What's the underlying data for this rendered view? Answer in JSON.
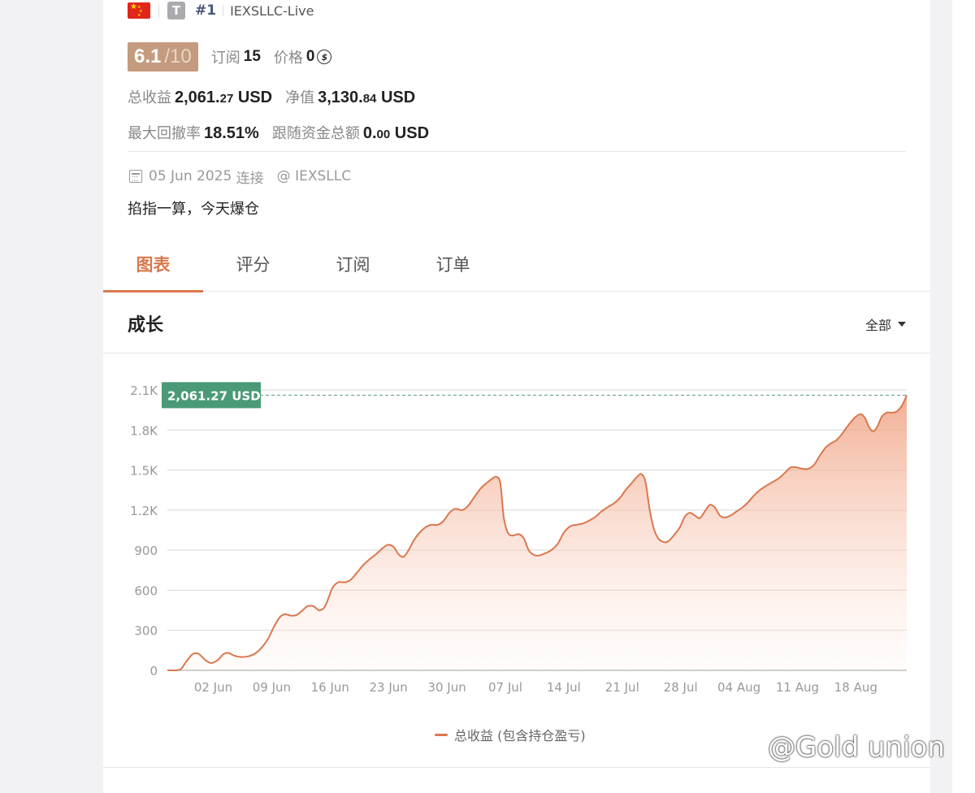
{
  "header": {
    "badge_letter": "T",
    "rank": "#1",
    "account_name": "IEXSLLC-Live"
  },
  "score": {
    "value": "6.1",
    "max": "/10",
    "subscribe_label": "订阅",
    "subscribe_count": "15",
    "price_label": "价格",
    "price_value": "0",
    "coin_glyph": "$"
  },
  "stats": {
    "total_profit_label": "总收益",
    "total_profit_int": "2,061.",
    "total_profit_dec": "27",
    "total_profit_unit": "USD",
    "equity_label": "净值",
    "equity_int": "3,130.",
    "equity_dec": "84",
    "equity_unit": "USD",
    "drawdown_label": "最大回撤率",
    "drawdown_value": "18.51%",
    "follow_label": "跟随资金总额",
    "follow_int": "0.",
    "follow_dec": "00",
    "follow_unit": "USD"
  },
  "connection": {
    "date": "05 Jun 2025",
    "connected_label": "连接",
    "broker": "@ IEXSLLC"
  },
  "description": "掐指一算，今天爆仓",
  "tabs": [
    {
      "label": "图表",
      "active": true
    },
    {
      "label": "评分",
      "active": false
    },
    {
      "label": "订阅",
      "active": false
    },
    {
      "label": "订单",
      "active": false
    }
  ],
  "section": {
    "title": "成长",
    "range_label": "全部"
  },
  "legend_label": "总收益 (包含持仓盈亏)",
  "watermark": "@Gold union",
  "colors": {
    "accent": "#d9784e",
    "score_bg": "#c49b7e",
    "tooltip_bg": "#4a9a78",
    "reference_line": "#5a9a82"
  },
  "chart_data": {
    "type": "area",
    "ylim": [
      0,
      2100
    ],
    "y_ticks": [
      0,
      300,
      600,
      900,
      1200,
      1500,
      1800,
      2100
    ],
    "y_tick_labels": [
      "0",
      "300",
      "600",
      "900",
      "1.2K",
      "1.5K",
      "1.8K",
      "2.1K"
    ],
    "x_tick_labels": [
      "02 Jun",
      "09 Jun",
      "16 Jun",
      "23 Jun",
      "30 Jun",
      "07 Jul",
      "14 Jul",
      "21 Jul",
      "28 Jul",
      "04 Aug",
      "11 Aug",
      "18 Aug"
    ],
    "x_range_days": [
      -5.5,
      77
    ],
    "current_value_label": "2,061.27 USD",
    "current_value": 2061.27,
    "series": [
      {
        "name": "总收益 (包含持仓盈亏)",
        "points": [
          [
            -5.5,
            0
          ],
          [
            -4,
            5
          ],
          [
            -3.3,
            60
          ],
          [
            -2.5,
            120
          ],
          [
            -1.8,
            125
          ],
          [
            -1,
            80
          ],
          [
            -0.3,
            55
          ],
          [
            0.5,
            75
          ],
          [
            1.2,
            120
          ],
          [
            1.8,
            130
          ],
          [
            2.5,
            110
          ],
          [
            3.3,
            100
          ],
          [
            4.2,
            105
          ],
          [
            5,
            125
          ],
          [
            5.8,
            170
          ],
          [
            6.6,
            240
          ],
          [
            7.3,
            330
          ],
          [
            8,
            400
          ],
          [
            8.6,
            420
          ],
          [
            9.3,
            410
          ],
          [
            10,
            415
          ],
          [
            10.7,
            450
          ],
          [
            11.3,
            480
          ],
          [
            12,
            480
          ],
          [
            12.7,
            450
          ],
          [
            13.3,
            470
          ],
          [
            13.8,
            540
          ],
          [
            14.3,
            620
          ],
          [
            15,
            660
          ],
          [
            15.8,
            660
          ],
          [
            16.5,
            680
          ],
          [
            17.2,
            730
          ],
          [
            18,
            790
          ],
          [
            18.7,
            830
          ],
          [
            19.5,
            870
          ],
          [
            20.2,
            910
          ],
          [
            20.9,
            940
          ],
          [
            21.6,
            925
          ],
          [
            22.2,
            870
          ],
          [
            22.8,
            850
          ],
          [
            23.4,
            900
          ],
          [
            24,
            970
          ],
          [
            24.7,
            1030
          ],
          [
            25.4,
            1070
          ],
          [
            26.1,
            1090
          ],
          [
            26.9,
            1090
          ],
          [
            27.6,
            1120
          ],
          [
            28.3,
            1180
          ],
          [
            29,
            1210
          ],
          [
            29.8,
            1200
          ],
          [
            30.5,
            1230
          ],
          [
            31.2,
            1290
          ],
          [
            32,
            1360
          ],
          [
            32.7,
            1400
          ],
          [
            33.3,
            1430
          ],
          [
            33.9,
            1450
          ],
          [
            34.4,
            1400
          ],
          [
            34.8,
            1150
          ],
          [
            35.3,
            1030
          ],
          [
            35.9,
            1010
          ],
          [
            36.6,
            1020
          ],
          [
            37.2,
            990
          ],
          [
            37.8,
            900
          ],
          [
            38.4,
            865
          ],
          [
            39,
            860
          ],
          [
            39.7,
            875
          ],
          [
            40.5,
            900
          ],
          [
            41.3,
            950
          ],
          [
            42,
            1030
          ],
          [
            42.8,
            1080
          ],
          [
            43.5,
            1090
          ],
          [
            44.3,
            1100
          ],
          [
            45,
            1120
          ],
          [
            45.8,
            1150
          ],
          [
            46.5,
            1190
          ],
          [
            47.2,
            1220
          ],
          [
            48,
            1250
          ],
          [
            48.7,
            1290
          ],
          [
            49.4,
            1350
          ],
          [
            50.1,
            1400
          ],
          [
            50.8,
            1450
          ],
          [
            51.3,
            1470
          ],
          [
            51.8,
            1410
          ],
          [
            52.3,
            1200
          ],
          [
            52.8,
            1060
          ],
          [
            53.3,
            990
          ],
          [
            54,
            960
          ],
          [
            54.6,
            970
          ],
          [
            55.3,
            1020
          ],
          [
            55.9,
            1070
          ],
          [
            56.5,
            1150
          ],
          [
            57.1,
            1180
          ],
          [
            57.7,
            1160
          ],
          [
            58.3,
            1140
          ],
          [
            58.9,
            1190
          ],
          [
            59.5,
            1240
          ],
          [
            60.1,
            1220
          ],
          [
            60.7,
            1160
          ],
          [
            61.3,
            1145
          ],
          [
            62,
            1160
          ],
          [
            62.7,
            1190
          ],
          [
            63.4,
            1220
          ],
          [
            64.1,
            1260
          ],
          [
            64.8,
            1310
          ],
          [
            65.5,
            1350
          ],
          [
            66.2,
            1380
          ],
          [
            67,
            1410
          ],
          [
            67.8,
            1440
          ],
          [
            68.5,
            1480
          ],
          [
            69.2,
            1520
          ],
          [
            69.9,
            1520
          ],
          [
            70.6,
            1510
          ],
          [
            71.3,
            1510
          ],
          [
            72,
            1540
          ],
          [
            72.7,
            1610
          ],
          [
            73.4,
            1670
          ],
          [
            74,
            1700
          ],
          [
            74.6,
            1720
          ],
          [
            75.2,
            1760
          ],
          [
            75.8,
            1810
          ],
          [
            76.4,
            1860
          ],
          [
            77,
            1900
          ],
          [
            77.6,
            1920
          ],
          [
            78.1,
            1890
          ],
          [
            78.6,
            1820
          ],
          [
            79.1,
            1790
          ],
          [
            79.6,
            1830
          ],
          [
            80.1,
            1900
          ],
          [
            80.7,
            1930
          ],
          [
            81.3,
            1930
          ],
          [
            81.9,
            1940
          ],
          [
            82.5,
            1980
          ],
          [
            83.1,
            2061.27
          ]
        ]
      }
    ]
  }
}
